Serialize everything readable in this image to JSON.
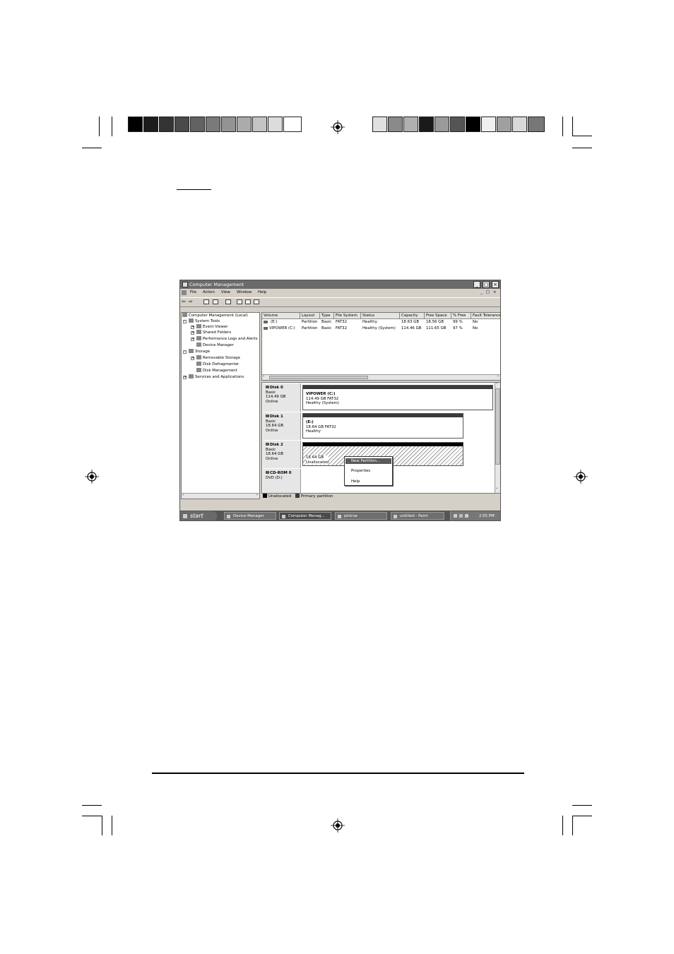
{
  "window": {
    "title": "Computer Management",
    "menu": [
      "File",
      "Action",
      "View",
      "Window",
      "Help"
    ],
    "controls": [
      "_",
      "□",
      "×"
    ],
    "inner_controls": [
      "_",
      "□",
      "×"
    ]
  },
  "tree": [
    {
      "label": "Computer Management (Local)",
      "icon": "computer-icon"
    },
    {
      "label": "System Tools",
      "icon": "tools-icon"
    },
    {
      "label": "Event Viewer",
      "icon": "event-viewer-icon"
    },
    {
      "label": "Shared Folders",
      "icon": "shared-folder-icon"
    },
    {
      "label": "Performance Logs and Alerts",
      "icon": "performance-icon"
    },
    {
      "label": "Device Manager",
      "icon": "device-manager-icon"
    },
    {
      "label": "Storage",
      "icon": "storage-icon"
    },
    {
      "label": "Removable Storage",
      "icon": "removable-storage-icon"
    },
    {
      "label": "Disk Defragmenter",
      "icon": "defrag-icon"
    },
    {
      "label": "Disk Management",
      "icon": "disk-management-icon"
    },
    {
      "label": "Services and Applications",
      "icon": "services-icon"
    }
  ],
  "volumes": {
    "columns": [
      "Volume",
      "Layout",
      "Type",
      "File System",
      "Status",
      "Capacity",
      "Free Space",
      "% Free",
      "Fault Tolerance"
    ],
    "rows": [
      [
        "(E:)",
        "Partition",
        "Basic",
        "FAT32",
        "Healthy",
        "18.63 GB",
        "18.56 GB",
        "99 %",
        "No"
      ],
      [
        "VIPOWER (C:)",
        "Partition",
        "Basic",
        "FAT32",
        "Healthy (System)",
        "114.46 GB",
        "111.65 GB",
        "97 %",
        "No"
      ]
    ]
  },
  "disks": [
    {
      "name": "Disk 0",
      "type": "Basic",
      "size": "114.49 GB",
      "state": "Online",
      "vol_title": "VIPOWER  (C:)",
      "vol_size": "114.49 GB FAT32",
      "vol_status": "Healthy (System)"
    },
    {
      "name": "Disk 1",
      "type": "Basic",
      "size": "18.64 GB",
      "state": "Online",
      "vol_title": "(E:)",
      "vol_size": "18.64 GB FAT32",
      "vol_status": "Healthy"
    },
    {
      "name": "Disk 2",
      "type": "Basic",
      "size": "18.64 GB",
      "state": "Online",
      "vol_title": "",
      "vol_size": "18.64 GB",
      "vol_status": "Unallocated"
    },
    {
      "name": "CD-ROM 0",
      "type": "DVD (D:)"
    }
  ],
  "context_menu": [
    "New Partition...",
    "Properties",
    "Help"
  ],
  "legend": [
    "Unallocated",
    "Primary partition"
  ],
  "taskbar": {
    "start": "start",
    "buttons": [
      "Device Manager",
      "Computer Manag...",
      "pictrue",
      "untitled - Paint"
    ],
    "clock": "2:55 PM"
  },
  "colors": {
    "unallocated": "#000000",
    "primary_partition": "#3a3a3a"
  }
}
